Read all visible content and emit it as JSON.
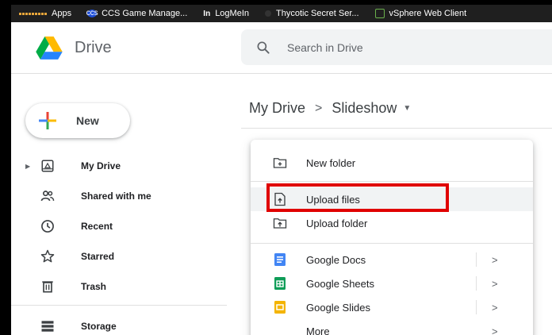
{
  "bookmarks": [
    {
      "label": "Apps",
      "icon": "apps-grid-icon"
    },
    {
      "label": "CCS Game Manage...",
      "icon": "ccs-icon"
    },
    {
      "label": "LogMeIn",
      "icon": "logmein-icon"
    },
    {
      "label": "Thycotic Secret Ser...",
      "icon": "thycotic-icon"
    },
    {
      "label": "vSphere Web Client",
      "icon": "vsphere-icon"
    }
  ],
  "header": {
    "title": "Drive",
    "search_placeholder": "Search in Drive"
  },
  "sidebar": {
    "new_label": "New",
    "items": [
      {
        "label": "My Drive",
        "icon": "my-drive-icon"
      },
      {
        "label": "Shared with me",
        "icon": "shared-icon"
      },
      {
        "label": "Recent",
        "icon": "clock-icon"
      },
      {
        "label": "Starred",
        "icon": "star-icon"
      },
      {
        "label": "Trash",
        "icon": "trash-icon"
      },
      {
        "label": "Storage",
        "icon": "storage-icon"
      }
    ]
  },
  "breadcrumb": {
    "root": "My Drive",
    "separator": ">",
    "current": "Slideshow"
  },
  "menu": {
    "items": [
      {
        "label": "New folder",
        "icon": "new-folder-icon"
      },
      {
        "label": "Upload files",
        "icon": "upload-file-icon",
        "highlighted": true
      },
      {
        "label": "Upload folder",
        "icon": "upload-folder-icon"
      },
      {
        "label": "Google Docs",
        "icon": "google-docs-icon",
        "submenu": true
      },
      {
        "label": "Google Sheets",
        "icon": "google-sheets-icon",
        "submenu": true
      },
      {
        "label": "Google Slides",
        "icon": "google-slides-icon",
        "submenu": true
      },
      {
        "label": "More",
        "icon": "more-icon",
        "submenu": true
      }
    ]
  },
  "colors": {
    "highlight_box": "#e00000",
    "docs": "#4285f4",
    "sheets": "#0f9d58",
    "slides": "#f4b400"
  }
}
